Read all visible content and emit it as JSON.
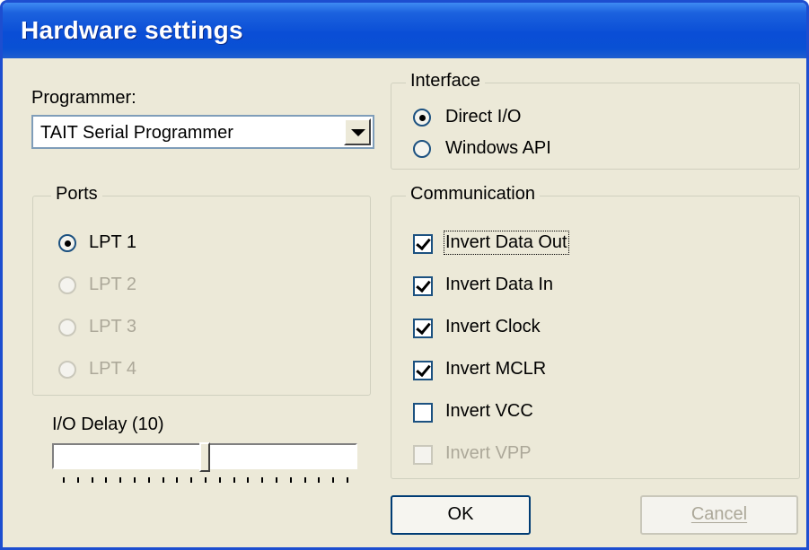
{
  "window": {
    "title": "Hardware settings"
  },
  "programmer": {
    "label": "Programmer:",
    "selected": "TAIT Serial Programmer"
  },
  "interface": {
    "title": "Interface",
    "options": [
      {
        "label": "Direct I/O",
        "checked": true
      },
      {
        "label": "Windows API",
        "checked": false
      }
    ]
  },
  "ports": {
    "title": "Ports",
    "options": [
      {
        "label": "LPT 1",
        "checked": true,
        "enabled": true
      },
      {
        "label": "LPT 2",
        "checked": false,
        "enabled": false
      },
      {
        "label": "LPT 3",
        "checked": false,
        "enabled": false
      },
      {
        "label": "LPT 4",
        "checked": false,
        "enabled": false
      }
    ]
  },
  "communication": {
    "title": "Communication",
    "options": [
      {
        "label": "Invert Data Out",
        "checked": true,
        "enabled": true
      },
      {
        "label": "Invert Data In",
        "checked": true,
        "enabled": true
      },
      {
        "label": "Invert Clock",
        "checked": true,
        "enabled": true
      },
      {
        "label": "Invert MCLR",
        "checked": true,
        "enabled": true
      },
      {
        "label": "Invert VCC",
        "checked": false,
        "enabled": true
      },
      {
        "label": "Invert VPP",
        "checked": false,
        "enabled": false
      }
    ]
  },
  "io_delay": {
    "label": "I/O Delay (10)",
    "value": 10,
    "min": 0,
    "max": 20
  },
  "buttons": {
    "ok": "OK",
    "cancel": "Cancel"
  },
  "colors": {
    "title_bar": "#0a4ed6",
    "dialog_bg": "#ece9d8",
    "disabled_text": "#aca899"
  }
}
